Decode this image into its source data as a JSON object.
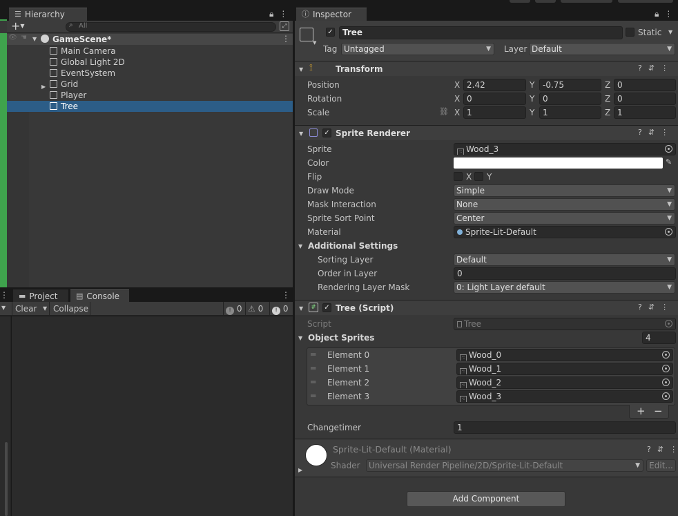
{
  "colors": {
    "panel": "#383838",
    "selection": "#2c5d87",
    "accent_green": "#3fa34d",
    "field": "#2a2a2a"
  },
  "hierarchy": {
    "tab_label": "Hierarchy",
    "search_placeholder": "All",
    "add_label": "+",
    "scene_name": "GameScene*",
    "items": [
      {
        "label": "Main Camera",
        "icon": "gameobject-icon"
      },
      {
        "label": "Global Light 2D",
        "icon": "gameobject-icon"
      },
      {
        "label": "EventSystem",
        "icon": "gameobject-icon"
      },
      {
        "label": "Grid",
        "icon": "gameobject-icon",
        "expandable": true
      },
      {
        "label": "Player",
        "icon": "gameobject-icon"
      },
      {
        "label": "Tree",
        "icon": "gameobject-icon",
        "selected": true
      }
    ]
  },
  "bottom": {
    "tabs": [
      {
        "label": "Project",
        "icon": "folder-icon"
      },
      {
        "label": "Console",
        "icon": "console-icon"
      }
    ],
    "toolbar": {
      "clear": "Clear",
      "collapse": "Collapse",
      "info_count": "0",
      "warn_count": "0",
      "error_count": "0"
    }
  },
  "inspector": {
    "tab_label": "Inspector",
    "object_name": "Tree",
    "static_label": "Static",
    "tag_label": "Tag",
    "tag_value": "Untagged",
    "layer_label": "Layer",
    "layer_value": "Default",
    "transform": {
      "title": "Transform",
      "position_label": "Position",
      "position": {
        "x": "2.42",
        "y": "-0.75",
        "z": "0"
      },
      "rotation_label": "Rotation",
      "rotation": {
        "x": "0",
        "y": "0",
        "z": "0"
      },
      "scale_label": "Scale",
      "scale": {
        "x": "1",
        "y": "1",
        "z": "1"
      },
      "axis_x": "X",
      "axis_y": "Y",
      "axis_z": "Z"
    },
    "sprite_renderer": {
      "title": "Sprite Renderer",
      "sprite_label": "Sprite",
      "sprite_value": "Wood_3",
      "color_label": "Color",
      "color_value": "#ffffff",
      "flip_label": "Flip",
      "flip_x": "X",
      "flip_y": "Y",
      "draw_mode_label": "Draw Mode",
      "draw_mode_value": "Simple",
      "mask_label": "Mask Interaction",
      "mask_value": "None",
      "sort_point_label": "Sprite Sort Point",
      "sort_point_value": "Center",
      "material_label": "Material",
      "material_value": "Sprite-Lit-Default",
      "additional_label": "Additional Settings",
      "sorting_layer_label": "Sorting Layer",
      "sorting_layer_value": "Default",
      "order_label": "Order in Layer",
      "order_value": "0",
      "rendering_mask_label": "Rendering Layer Mask",
      "rendering_mask_value": "0: Light Layer default"
    },
    "tree_script": {
      "title": "Tree (Script)",
      "script_label": "Script",
      "script_value": "Tree",
      "object_sprites_label": "Object Sprites",
      "object_sprites_count": "4",
      "elements": [
        {
          "label": "Element 0",
          "value": "Wood_0"
        },
        {
          "label": "Element 1",
          "value": "Wood_1"
        },
        {
          "label": "Element 2",
          "value": "Wood_2"
        },
        {
          "label": "Element 3",
          "value": "Wood_3"
        }
      ],
      "changetimer_label": "Changetimer",
      "changetimer_value": "1"
    },
    "material": {
      "title": "Sprite-Lit-Default (Material)",
      "shader_label": "Shader",
      "shader_value": "Universal Render Pipeline/2D/Sprite-Lit-Default",
      "edit_label": "Edit..."
    },
    "add_component": "Add Component"
  }
}
